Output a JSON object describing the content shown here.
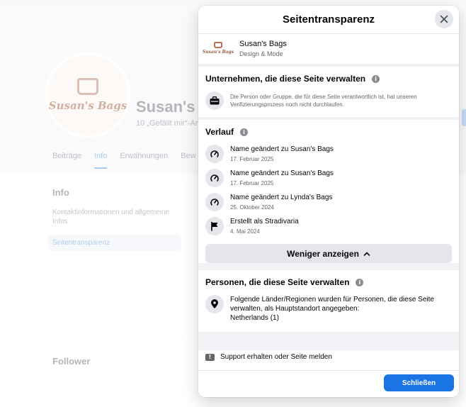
{
  "background": {
    "page_logo_text": "Susan's Bags",
    "page_title": "Susan's B",
    "page_subtitle": "10 „Gefällt mir“-An",
    "tabs": [
      "Beiträge",
      "Info",
      "Erwähnungen",
      "Bew"
    ],
    "info_card": {
      "title": "Info",
      "link": "Kontaktinformationen und allgemeine Infos",
      "selected": "Seitentransparenz"
    },
    "follower_title": "Follower"
  },
  "modal": {
    "title": "Seitentransparenz",
    "close_icon": "close-icon",
    "page": {
      "name": "Susan's Bags",
      "category": "Design & Mode",
      "logo_text": "Susan's Bags"
    },
    "companies": {
      "title": "Unternehmen, die diese Seite verwalten",
      "description": "Die Person oder Gruppe, die für diese Seite verantwortlich ist, hat unseren Verifizierungsprozess noch nicht durchlaufen."
    },
    "history": {
      "title": "Verlauf",
      "items": [
        {
          "text": "Name geändert zu Susan's Bags",
          "date": "17. Februar 2025",
          "icon": "rename-icon"
        },
        {
          "text": "Name geändert zu Susan's Bags",
          "date": "17. Februar 2025",
          "icon": "rename-icon"
        },
        {
          "text": "Name geändert zu Lynda's Bags",
          "date": "25. Oktober 2024",
          "icon": "rename-icon"
        },
        {
          "text": "Erstellt als Stradivaria",
          "date": "4. Mai 2024",
          "icon": "flag-icon"
        }
      ],
      "less_label": "Weniger anzeigen"
    },
    "people": {
      "title": "Personen, die diese Seite verwalten",
      "text": "Folgende Länder/Regionen wurden für Personen, die diese Seite verwalten, als Hauptstandort angegeben:",
      "location": "Netherlands (1)"
    },
    "support_label": "Support erhalten oder Seite melden",
    "close_button": "Schließen"
  },
  "colors": {
    "primary": "#1b74e4",
    "secondary_bg": "#e4e6eb",
    "text_secondary": "#65676b"
  }
}
